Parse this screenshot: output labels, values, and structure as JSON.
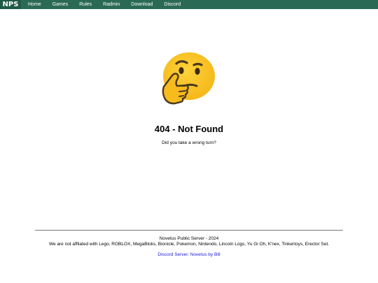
{
  "nav": {
    "logo": "NPS",
    "items": [
      {
        "label": "Home"
      },
      {
        "label": "Games"
      },
      {
        "label": "Rules"
      },
      {
        "label": "Radmin"
      },
      {
        "label": "Download"
      },
      {
        "label": "Discord"
      }
    ]
  },
  "main": {
    "emoji_icon": "thinking-face-icon",
    "title": "404 - Not Found",
    "subtitle": "Did you take a wrong turn?"
  },
  "footer": {
    "line1": "Novetus Public Server - 2024",
    "line2": "We are not affliated with Lego, ROBLOX, MegaBloks, Bionicle, Pokemon, Nintendo, Lincoln Logs, Yu Gi Oh, K'nex, Tinkertoys, Erector Set.",
    "link1": "Discord Server.",
    "link2": "Novetus by Bill"
  },
  "colors": {
    "navbar": "#2a6a55",
    "link": "#1a1ad6"
  }
}
